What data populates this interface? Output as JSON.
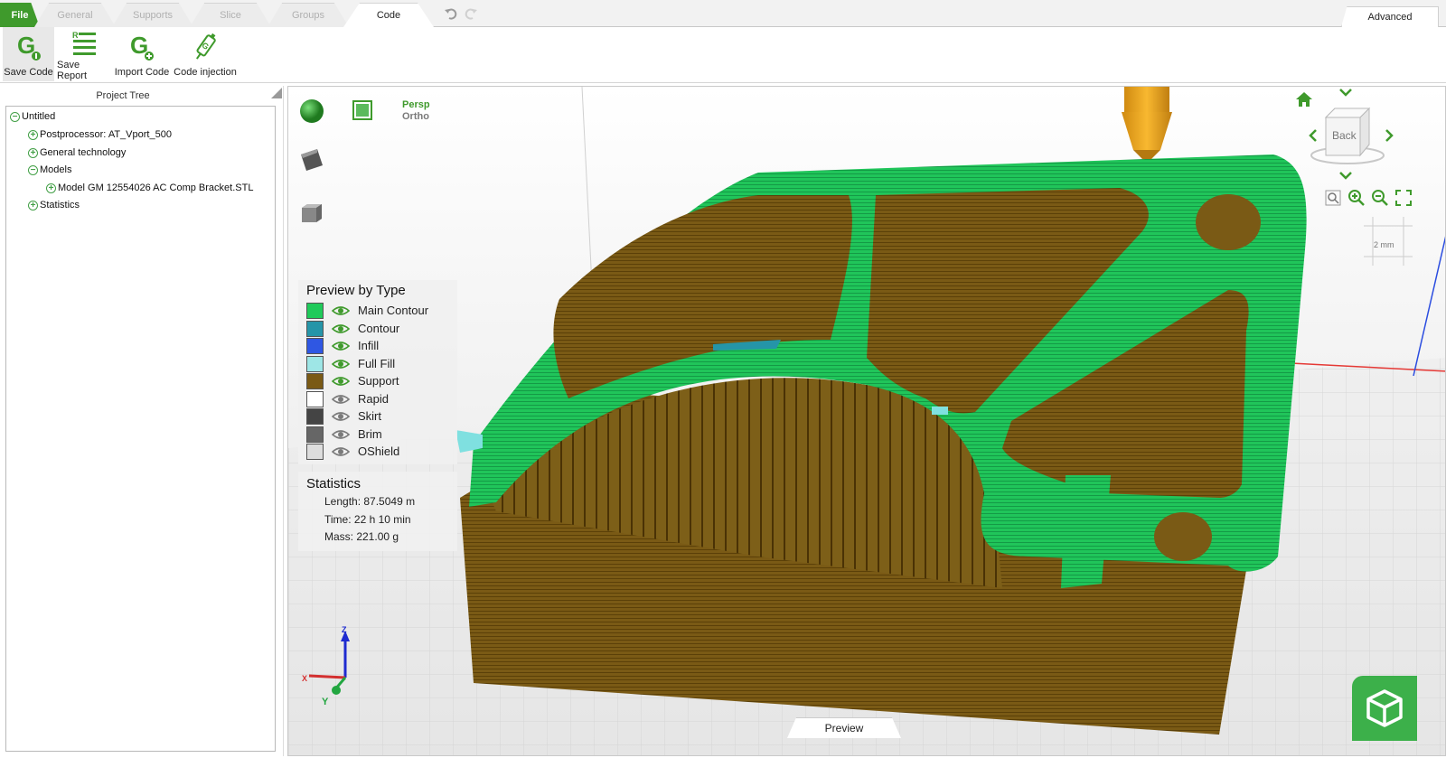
{
  "tabs": [
    {
      "label": "File"
    },
    {
      "label": "General"
    },
    {
      "label": "Supports"
    },
    {
      "label": "Slice"
    },
    {
      "label": "Groups"
    },
    {
      "label": "Code"
    }
  ],
  "active_tab": "Code",
  "advanced_tab": "Advanced",
  "ribbon": {
    "save_code": "Save Code",
    "save_report": "Save Report",
    "import_code": "Import Code",
    "code_injection": "Code injection"
  },
  "tree": {
    "title": "Project Tree",
    "root": "Untitled",
    "postprocessor": "Postprocessor: AT_Vport_500",
    "general_technology": "General technology",
    "models": "Models",
    "model_file": "Model GM 12554026 AC Comp Bracket.STL",
    "statistics": "Statistics"
  },
  "viewport": {
    "projection_persp": "Persp",
    "projection_ortho": "Ortho",
    "view_cube_face": "Back",
    "ruler_label": "2 mm",
    "preview_tab": "Preview",
    "axis_z": "Z",
    "axis_x": "X",
    "axis_y": "Y"
  },
  "legend": {
    "title": "Preview by Type",
    "items": [
      {
        "label": "Main Contour",
        "color": "#1fca5a",
        "visible": true
      },
      {
        "label": "Contour",
        "color": "#2595a8",
        "visible": true
      },
      {
        "label": "Infill",
        "color": "#2f57e3",
        "visible": true
      },
      {
        "label": "Full Fill",
        "color": "#9ee6e6",
        "visible": true
      },
      {
        "label": "Support",
        "color": "#7a5a15",
        "visible": true
      },
      {
        "label": "Rapid",
        "color": "#ffffff",
        "visible": false
      },
      {
        "label": "Skirt",
        "color": "#444444",
        "visible": false
      },
      {
        "label": "Brim",
        "color": "#666666",
        "visible": false
      },
      {
        "label": "OShield",
        "color": "#dddddd",
        "visible": false
      }
    ]
  },
  "statistics": {
    "title": "Statistics",
    "length": "Length: 87.5049 m",
    "time": "Time: 22 h 10 min",
    "mass": "Mass: 221.00 g"
  },
  "colors": {
    "accent": "#3f9a2c",
    "main_contour": "#1fca5a",
    "support": "#7a5a15"
  }
}
